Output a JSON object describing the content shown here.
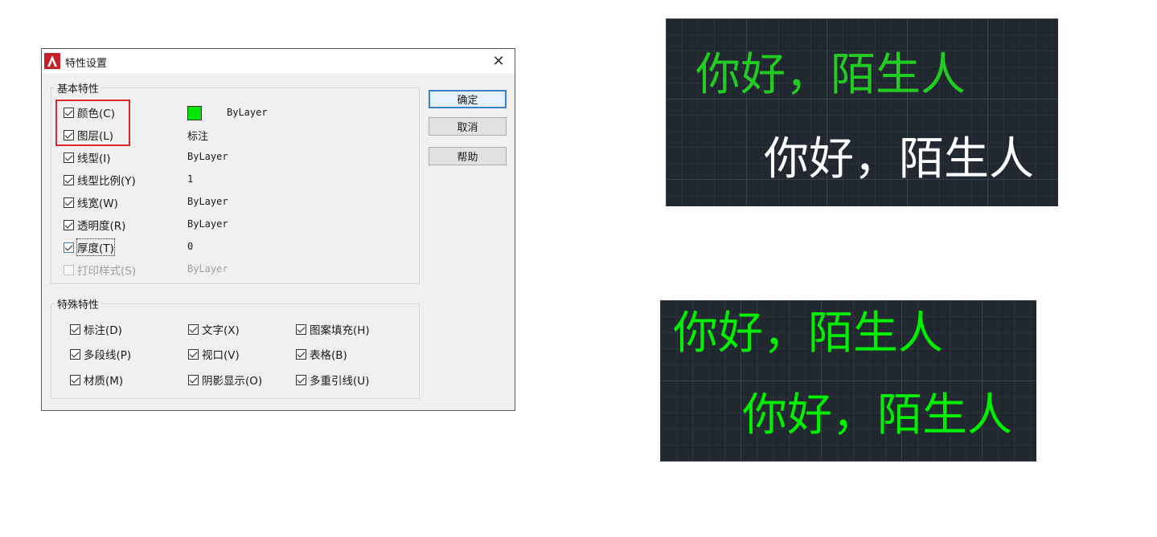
{
  "dialog": {
    "title": "特性设置",
    "close_glyph": "✕",
    "basic_group": {
      "label": "基本特性",
      "items": [
        {
          "label": "颜色(C)",
          "value": "ByLayer",
          "checked": true
        },
        {
          "label": "图层(L)",
          "value": "标注",
          "checked": true
        },
        {
          "label": "线型(I)",
          "value": "ByLayer",
          "checked": true
        },
        {
          "label": "线型比例(Y)",
          "value": "1",
          "checked": true
        },
        {
          "label": "线宽(W)",
          "value": "ByLayer",
          "checked": true
        },
        {
          "label": "透明度(R)",
          "value": "ByLayer",
          "checked": true
        },
        {
          "label": "厚度(T)",
          "value": "0",
          "checked": true
        },
        {
          "label": "打印样式(S)",
          "value": "ByLayer",
          "checked": false,
          "disabled": true
        }
      ],
      "color_swatch": "#00e600"
    },
    "special_group": {
      "label": "特殊特性",
      "items": [
        {
          "label": "标注(D)",
          "checked": true
        },
        {
          "label": "文字(X)",
          "checked": true
        },
        {
          "label": "图案填充(H)",
          "checked": true
        },
        {
          "label": "多段线(P)",
          "checked": true
        },
        {
          "label": "视口(V)",
          "checked": true
        },
        {
          "label": "表格(B)",
          "checked": true
        },
        {
          "label": "材质(M)",
          "checked": true
        },
        {
          "label": "阴影显示(O)",
          "checked": true
        },
        {
          "label": "多重引线(U)",
          "checked": true
        }
      ]
    },
    "buttons": {
      "ok": "确定",
      "cancel": "取消",
      "help": "帮助"
    }
  },
  "previews": {
    "before": {
      "line1": "你好，陌生人",
      "line2": "你好，陌生人",
      "line1_color": "#22cc22",
      "line2_color": "#ffffff"
    },
    "after": {
      "line1": "你好，陌生人",
      "line2": "你好，陌生人",
      "line1_color": "#00ee00",
      "line2_color": "#00ee00"
    }
  }
}
